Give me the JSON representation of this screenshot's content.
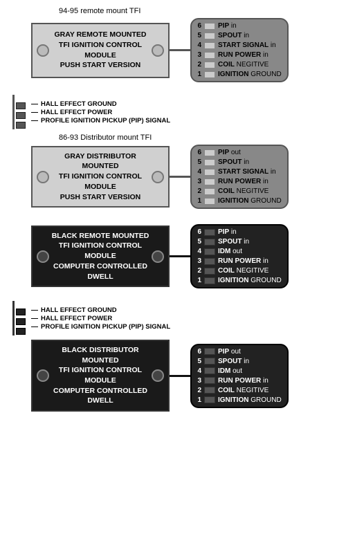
{
  "modules": [
    {
      "id": "gray-remote",
      "sectionLabel": "94-95 remote mount TFI",
      "moduleText": "GRAY REMOTE MOUNTED\nTFI IGNITION CONTROL MODULE\nPUSH START VERSION",
      "isBlack": false,
      "pins": [
        {
          "num": 6,
          "label": "PIP in",
          "bold": "PIP"
        },
        {
          "num": 5,
          "label": "SPOUT in",
          "bold": "SPOUT"
        },
        {
          "num": 4,
          "label": "START SIGNAL in",
          "bold": "START SIGNAL"
        },
        {
          "num": 3,
          "label": "RUN POWER in",
          "bold": "RUN POWER"
        },
        {
          "num": 2,
          "label": "COIL NEGITIVE",
          "bold": "COIL"
        },
        {
          "num": 1,
          "label": "IGNITION GROUND",
          "bold": "IGNITION"
        }
      ]
    },
    {
      "id": "gray-distributor",
      "sectionLabel": "86-93 Distributor mount TFI",
      "moduleText": "GRAY DISTRIBUTOR MOUNTED\nTFI IGNITION CONTROL MODULE\nPUSH START VERSION",
      "isBlack": false,
      "showLeftWires": true,
      "pins": [
        {
          "num": 6,
          "label": "PIP out",
          "bold": "PIP"
        },
        {
          "num": 5,
          "label": "SPOUT in",
          "bold": "SPOUT"
        },
        {
          "num": 4,
          "label": "START SIGNAL in",
          "bold": "START SIGNAL"
        },
        {
          "num": 3,
          "label": "RUN POWER in",
          "bold": "RUN POWER"
        },
        {
          "num": 2,
          "label": "COIL NEGITIVE",
          "bold": "COIL"
        },
        {
          "num": 1,
          "label": "IGNITION GROUND",
          "bold": "IGNITION"
        }
      ]
    },
    {
      "id": "black-remote",
      "sectionLabel": "",
      "moduleText": "BLACK REMOTE MOUNTED\nTFI IGNITION CONTROL MODULE\nCOMPUTER CONTROLLED DWELL",
      "isBlack": true,
      "pins": [
        {
          "num": 6,
          "label": "PIP in",
          "bold": "PIP"
        },
        {
          "num": 5,
          "label": "SPOUT in",
          "bold": "SPOUT"
        },
        {
          "num": 4,
          "label": "IDM out",
          "bold": "IDM"
        },
        {
          "num": 3,
          "label": "RUN POWER in",
          "bold": "RUN POWER"
        },
        {
          "num": 2,
          "label": "COIL NEGITIVE",
          "bold": "COIL"
        },
        {
          "num": 1,
          "label": "IGNITION GROUND",
          "bold": "IGNITION"
        }
      ]
    },
    {
      "id": "black-distributor",
      "sectionLabel": "",
      "moduleText": "BLACK DISTRIBUTOR MOUNTED\nTFI IGNITION CONTROL MODULE\nCOMPUTER CONTROLLED DWELL",
      "isBlack": true,
      "showLeftWires": true,
      "pins": [
        {
          "num": 6,
          "label": "PIP out",
          "bold": "PIP"
        },
        {
          "num": 5,
          "label": "SPOUT in",
          "bold": "SPOUT"
        },
        {
          "num": 4,
          "label": "IDM out",
          "bold": "IDM"
        },
        {
          "num": 3,
          "label": "RUN POWER in",
          "bold": "RUN POWER"
        },
        {
          "num": 2,
          "label": "COIL NEGITIVE",
          "bold": "COIL"
        },
        {
          "num": 1,
          "label": "IGNITION GROUND",
          "bold": "IGNITION"
        }
      ]
    }
  ],
  "leftWires": {
    "labels": [
      "HALL EFFECT GROUND",
      "HALL EFFECT POWER",
      "PROFILE IGNITION PICKUP (PIP) SIGNAL"
    ]
  }
}
